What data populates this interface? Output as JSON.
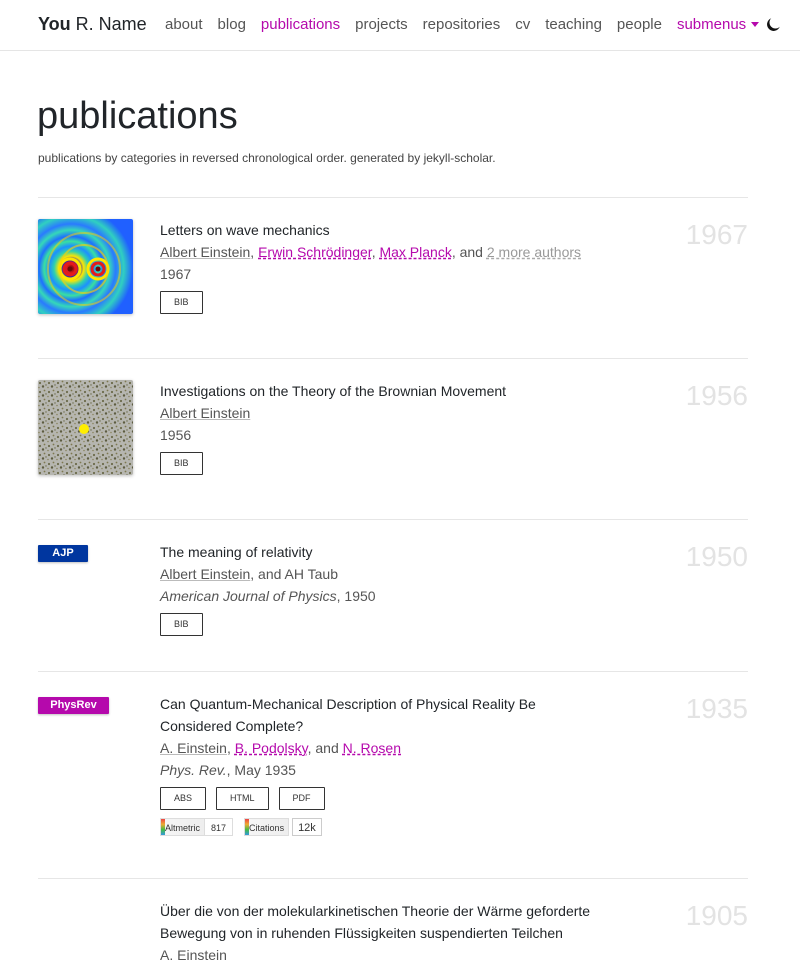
{
  "nav": {
    "brand_bold": "You",
    "brand_rest": " R. Name",
    "items": [
      "about",
      "blog",
      "publications",
      "projects",
      "repositories",
      "cv",
      "teaching",
      "people"
    ],
    "dropdown": "submenus",
    "active": "publications"
  },
  "header": {
    "title": "publications",
    "description": "publications by categories in reversed chronological order. generated by jekyll-scholar."
  },
  "pubs": [
    {
      "year": "1967",
      "title": "Letters on wave mechanics",
      "authors": {
        "a1": "Albert Einstein",
        "a2": "Erwin Schrödinger",
        "a3": "Max Planck",
        "sep_and": ", and ",
        "more": "2 more authors"
      },
      "periodical": "1967",
      "buttons": [
        "BIB"
      ]
    },
    {
      "year": "1956",
      "title": "Investigations on the Theory of the Brownian Movement",
      "authors": {
        "a1": "Albert Einstein"
      },
      "periodical": "1956",
      "buttons": [
        "BIB"
      ]
    },
    {
      "year": "1950",
      "abbr": "AJP",
      "abbr_color": "#00369f",
      "title": "The meaning of relativity",
      "authors": {
        "a1": "Albert Einstein",
        "rest": ", and AH Taub"
      },
      "journal": "American Journal of Physics",
      "journal_suffix": ", 1950",
      "buttons": [
        "BIB"
      ]
    },
    {
      "year": "1935",
      "abbr": "PhysRev",
      "abbr_color": "#b509ac",
      "title": "Can Quantum-Mechanical Description of Physical Reality Be Considered Complete?",
      "authors": {
        "a1": "A. Einstein",
        "a2": "B. Podolsky",
        "sep_and": ", and ",
        "a3": "N. Rosen"
      },
      "journal": "Phys. Rev.",
      "journal_suffix": ", May 1935",
      "buttons": [
        "ABS",
        "HTML",
        "PDF"
      ],
      "altmetric_label": "Altmetric",
      "altmetric_value": "817",
      "citations_label": "Citations",
      "citations_value": "12k"
    },
    {
      "year": "1905",
      "title": "Über die von der molekularkinetischen Theorie der Wärme geforderte Bewegung von in ruhenden Flüssigkeiten suspendierten Teilchen",
      "authors": {
        "a1": "A. Einstein"
      }
    }
  ]
}
